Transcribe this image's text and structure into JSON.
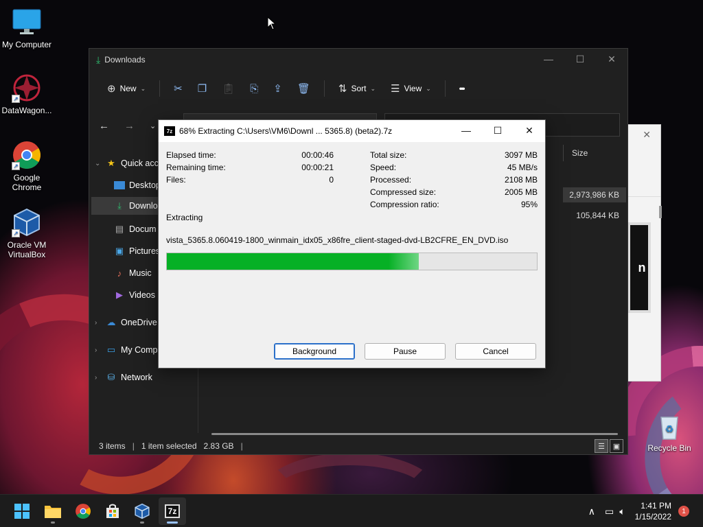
{
  "desktop": {
    "icons": [
      {
        "label": "My Computer",
        "icon": "monitor-icon"
      },
      {
        "label": "DataWagon...",
        "icon": "datawagon-icon"
      },
      {
        "label": "Google Chrome",
        "icon": "chrome-icon"
      },
      {
        "label": "Oracle VM VirtualBox",
        "icon": "virtualbox-icon"
      },
      {
        "label": "Recycle Bin",
        "icon": "recycle-bin-icon"
      }
    ]
  },
  "explorer": {
    "title": "Downloads",
    "toolbar": {
      "new_label": "New",
      "sort_label": "Sort",
      "view_label": "View",
      "more_label": "•••"
    },
    "sidebar": [
      {
        "label": "Quick access",
        "display": "Quick acc",
        "icon": "star-icon",
        "expandable": true
      },
      {
        "label": "Desktop",
        "display": "Desktop",
        "icon": "desktop-folder-icon"
      },
      {
        "label": "Downloads",
        "display": "Downlo",
        "icon": "download-icon",
        "selected": true
      },
      {
        "label": "Documents",
        "display": "Docum",
        "icon": "documents-icon"
      },
      {
        "label": "Pictures",
        "display": "Pictures",
        "icon": "pictures-icon"
      },
      {
        "label": "Music",
        "display": "Music",
        "icon": "music-icon"
      },
      {
        "label": "Videos",
        "display": "Videos",
        "icon": "videos-icon"
      },
      {
        "label": "OneDrive",
        "display": "OneDrive",
        "icon": "cloud-icon",
        "expandable": true
      },
      {
        "label": "My Computer",
        "display": "My Comp",
        "icon": "computer-icon",
        "expandable": true
      },
      {
        "label": "Network",
        "display": "Network",
        "icon": "network-icon",
        "expandable": true
      }
    ],
    "columns": {
      "size": "Size"
    },
    "files": [
      {
        "size": "2,973,986 KB",
        "selected": true
      },
      {
        "size": "105,844 KB"
      }
    ],
    "status": {
      "items": "3 items",
      "selected": "1 item selected",
      "selected_size": "2.83 GB",
      "sep": "|"
    }
  },
  "dialog": {
    "title": "68% Extracting C:\\Users\\VM6\\Downl ... 5365.8) (beta2).7z",
    "app_icon_text": "7z",
    "left_stats": [
      {
        "label": "Elapsed time:",
        "value": "00:00:46"
      },
      {
        "label": "Remaining time:",
        "value": "00:00:21"
      },
      {
        "label": "Files:",
        "value": "0"
      }
    ],
    "right_stats": [
      {
        "label": "Total size:",
        "value": "3097 MB"
      },
      {
        "label": "Speed:",
        "value": "45 MB/s"
      },
      {
        "label": "Processed:",
        "value": "2108 MB"
      },
      {
        "label": "Compressed size:",
        "value": "2005 MB"
      },
      {
        "label": "Compression ratio:",
        "value": "95%"
      }
    ],
    "status_label": "Extracting",
    "current_file": "vista_5365.8.060419-1800_winmain_idx05_x86fre_client-staged-dvd-LB2CFRE_EN_DVD.iso",
    "progress": 0.68,
    "buttons": {
      "background": "Background",
      "pause": "Pause",
      "cancel": "Cancel"
    }
  },
  "taskbar": {
    "apps": [
      {
        "name": "start",
        "icon": "windows-start-icon"
      },
      {
        "name": "file-explorer",
        "icon": "folder-icon",
        "running": true
      },
      {
        "name": "chrome",
        "icon": "chrome-icon"
      },
      {
        "name": "store",
        "icon": "store-icon"
      },
      {
        "name": "virtualbox",
        "icon": "virtualbox-icon",
        "running": true
      },
      {
        "name": "7zip",
        "icon": "7zip-icon",
        "active": true
      }
    ],
    "time": "1:41 PM",
    "date": "1/15/2022",
    "notification_count": "1"
  },
  "colors": {
    "progress_fill": "#06b025",
    "accent": "#2a6fc9",
    "explorer_bg": "#202020"
  }
}
